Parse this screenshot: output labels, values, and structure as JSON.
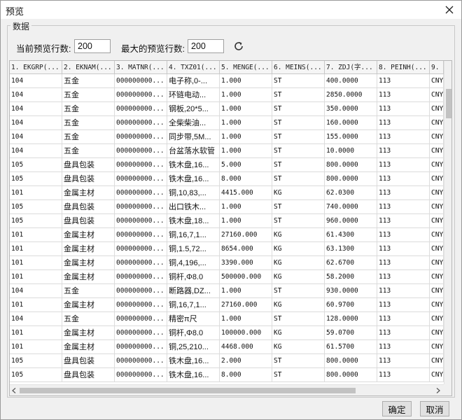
{
  "window": {
    "title": "预览"
  },
  "group": {
    "label": "数据"
  },
  "params": {
    "current_label": "当前预览行数:",
    "current_value": "200",
    "max_label": "最大的预览行数:",
    "max_value": "200"
  },
  "table": {
    "headers": [
      "1. EKGRP(...",
      "2. EKNAM(...",
      "3. MATNR(...",
      "4. TXZ01(...",
      "5. MENGE(...",
      "6. MEINS(...",
      "7. ZDJ(字...",
      "8. PEINH(...",
      "9."
    ],
    "rows": [
      [
        "104",
        "五金",
        "000000000...",
        "电子称,0-...",
        "1.000",
        "ST",
        "400.0000",
        "113",
        "CNY"
      ],
      [
        "104",
        "五金",
        "000000000...",
        "环链电动...",
        "1.000",
        "ST",
        "2850.0000",
        "113",
        "CNY"
      ],
      [
        "104",
        "五金",
        "000000000...",
        "钢板,20*5...",
        "1.000",
        "ST",
        "350.0000",
        "113",
        "CNY"
      ],
      [
        "104",
        "五金",
        "000000000...",
        "全柴柴油...",
        "1.000",
        "ST",
        "160.0000",
        "113",
        "CNY"
      ],
      [
        "104",
        "五金",
        "000000000...",
        "同步带,5M...",
        "1.000",
        "ST",
        "155.0000",
        "113",
        "CNY"
      ],
      [
        "104",
        "五金",
        "000000000...",
        "台盆落水软管",
        "1.000",
        "ST",
        "10.0000",
        "113",
        "CNY"
      ],
      [
        "105",
        "盘具包装",
        "000000000...",
        "铁木盘,16...",
        "5.000",
        "ST",
        "800.0000",
        "113",
        "CNY"
      ],
      [
        "105",
        "盘具包装",
        "000000000...",
        "铁木盘,16...",
        "8.000",
        "ST",
        "800.0000",
        "113",
        "CNY"
      ],
      [
        "101",
        "金属主材",
        "000000000...",
        "铜,10,83,...",
        "4415.000",
        "KG",
        "62.0300",
        "113",
        "CNY"
      ],
      [
        "105",
        "盘具包装",
        "000000000...",
        "出口铁木...",
        "1.000",
        "ST",
        "740.0000",
        "113",
        "CNY"
      ],
      [
        "105",
        "盘具包装",
        "000000000...",
        "铁木盘,18...",
        "1.000",
        "ST",
        "960.0000",
        "113",
        "CNY"
      ],
      [
        "101",
        "金属主材",
        "000000000...",
        "铜,16,7,1...",
        "27160.000",
        "KG",
        "61.4300",
        "113",
        "CNY"
      ],
      [
        "101",
        "金属主材",
        "000000000...",
        "铜,1.5,72...",
        "8654.000",
        "KG",
        "63.1300",
        "113",
        "CNY"
      ],
      [
        "101",
        "金属主材",
        "000000000...",
        "铜,4,196,...",
        "3390.000",
        "KG",
        "62.6700",
        "113",
        "CNY"
      ],
      [
        "101",
        "金属主材",
        "000000000...",
        "铜杆,Φ8.0",
        "500000.000",
        "KG",
        "58.2000",
        "113",
        "CNY"
      ],
      [
        "104",
        "五金",
        "000000000...",
        "断路器,DZ...",
        "1.000",
        "ST",
        "930.0000",
        "113",
        "CNY"
      ],
      [
        "101",
        "金属主材",
        "000000000...",
        "铜,16,7,1...",
        "27160.000",
        "KG",
        "60.9700",
        "113",
        "CNY"
      ],
      [
        "104",
        "五金",
        "000000000...",
        "精密π尺",
        "1.000",
        "ST",
        "128.0000",
        "113",
        "CNY"
      ],
      [
        "101",
        "金属主材",
        "000000000...",
        "铜杆,Φ8.0",
        "100000.000",
        "KG",
        "59.0700",
        "113",
        "CNY"
      ],
      [
        "101",
        "金属主材",
        "000000000...",
        "铜,25,210...",
        "4468.000",
        "KG",
        "61.5700",
        "113",
        "CNY"
      ],
      [
        "105",
        "盘具包装",
        "000000000...",
        "铁木盘,16...",
        "2.000",
        "ST",
        "800.0000",
        "113",
        "CNY"
      ],
      [
        "105",
        "盘具包装",
        "000000000...",
        "铁木盘,16...",
        "8.000",
        "ST",
        "800.0000",
        "113",
        "CNY"
      ]
    ]
  },
  "buttons": {
    "ok": "确定",
    "cancel": "取消"
  },
  "icons": {
    "close": "close-icon",
    "refresh": "refresh-icon"
  }
}
